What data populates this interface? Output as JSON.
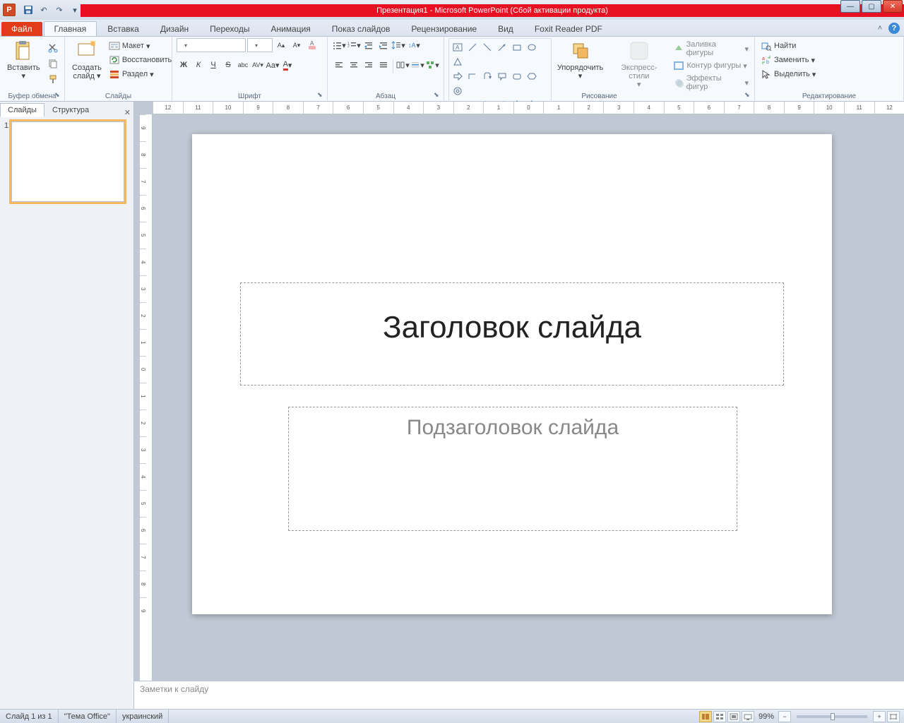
{
  "app_icon_letter": "P",
  "title": "Презентация1  -  Microsoft PowerPoint (Сбой активации продукта)",
  "tabs": {
    "file": "Файл",
    "home": "Главная",
    "insert": "Вставка",
    "design": "Дизайн",
    "transitions": "Переходы",
    "animations": "Анимация",
    "slideshow": "Показ слайдов",
    "review": "Рецензирование",
    "view": "Вид",
    "foxit": "Foxit Reader PDF"
  },
  "ribbon": {
    "clipboard": {
      "label": "Буфер обмена",
      "paste": "Вставить"
    },
    "slides": {
      "label": "Слайды",
      "new_slide": "Создать слайд",
      "layout": "Макет",
      "reset": "Восстановить",
      "section": "Раздел"
    },
    "font": {
      "label": "Шрифт"
    },
    "paragraph": {
      "label": "Абзац"
    },
    "drawing": {
      "label": "Рисование",
      "arrange": "Упорядочить",
      "quick_styles": "Экспресс-стили",
      "fill": "Заливка фигуры",
      "outline": "Контур фигуры",
      "effects": "Эффекты фигур"
    },
    "editing": {
      "label": "Редактирование",
      "find": "Найти",
      "replace": "Заменить",
      "select": "Выделить"
    }
  },
  "panel": {
    "slides_tab": "Слайды",
    "outline_tab": "Структура",
    "thumb_num": "1"
  },
  "canvas": {
    "title_ph": "Заголовок слайда",
    "subtitle_ph": "Подзаголовок слайда"
  },
  "notes": {
    "placeholder": "Заметки к слайду"
  },
  "status": {
    "slide_pos": "Слайд 1 из 1",
    "theme": "\"Тема Office\"",
    "language": "украинский",
    "zoom": "99%"
  },
  "ruler_marks": [
    "12",
    "11",
    "10",
    "9",
    "8",
    "7",
    "6",
    "5",
    "4",
    "3",
    "2",
    "1",
    "0",
    "1",
    "2",
    "3",
    "4",
    "5",
    "6",
    "7",
    "8",
    "9",
    "10",
    "11",
    "12"
  ],
  "ruler_v_marks": [
    "9",
    "8",
    "7",
    "6",
    "5",
    "4",
    "3",
    "2",
    "1",
    "0",
    "1",
    "2",
    "3",
    "4",
    "5",
    "6",
    "7",
    "8",
    "9"
  ]
}
